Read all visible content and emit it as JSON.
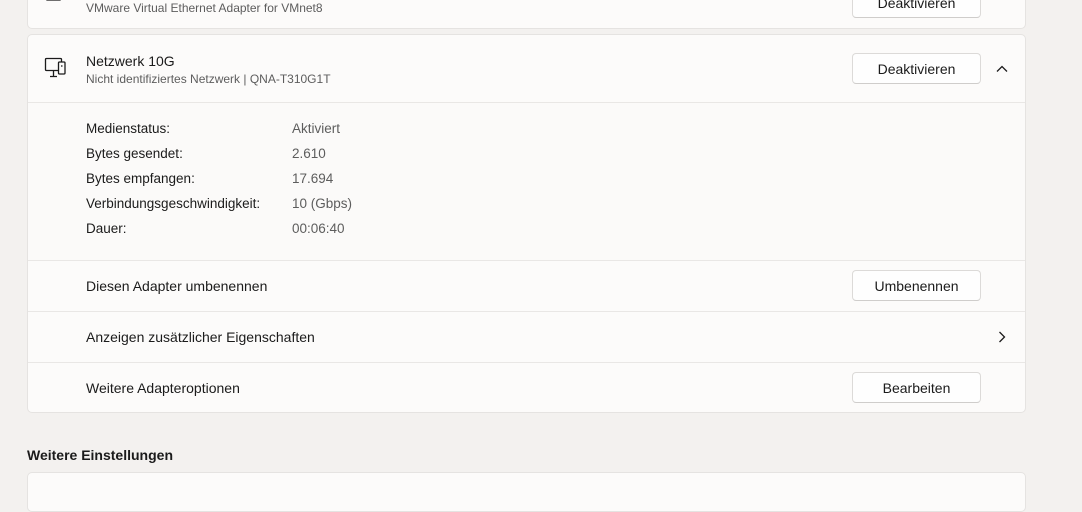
{
  "prev_adapter": {
    "subtitle": "VMware Virtual Ethernet Adapter for VMnet8",
    "button_label": "Deaktivieren"
  },
  "adapter": {
    "name": "Netzwerk 10G",
    "subtitle": "Nicht identifiziertes Netzwerk | QNA-T310G1T",
    "deactivate_label": "Deaktivieren",
    "icon": "network-adapter-icon",
    "expand_icon": "chevron-up-icon"
  },
  "properties": [
    {
      "label": "Medienstatus:",
      "value": "Aktiviert"
    },
    {
      "label": "Bytes gesendet:",
      "value": "2.610"
    },
    {
      "label": "Bytes empfangen:",
      "value": "17.694"
    },
    {
      "label": "Verbindungsgeschwindigkeit:",
      "value": "10 (Gbps)"
    },
    {
      "label": "Dauer:",
      "value": "00:06:40"
    }
  ],
  "rename_row": {
    "label": "Diesen Adapter umbenennen",
    "button_label": "Umbenennen"
  },
  "more_props_row": {
    "label": "Anzeigen zusätzlicher Eigenschaften",
    "icon": "chevron-right-icon"
  },
  "options_row": {
    "label": "Weitere Adapteroptionen",
    "button_label": "Bearbeiten"
  },
  "section_heading": "Weitere Einstellungen"
}
